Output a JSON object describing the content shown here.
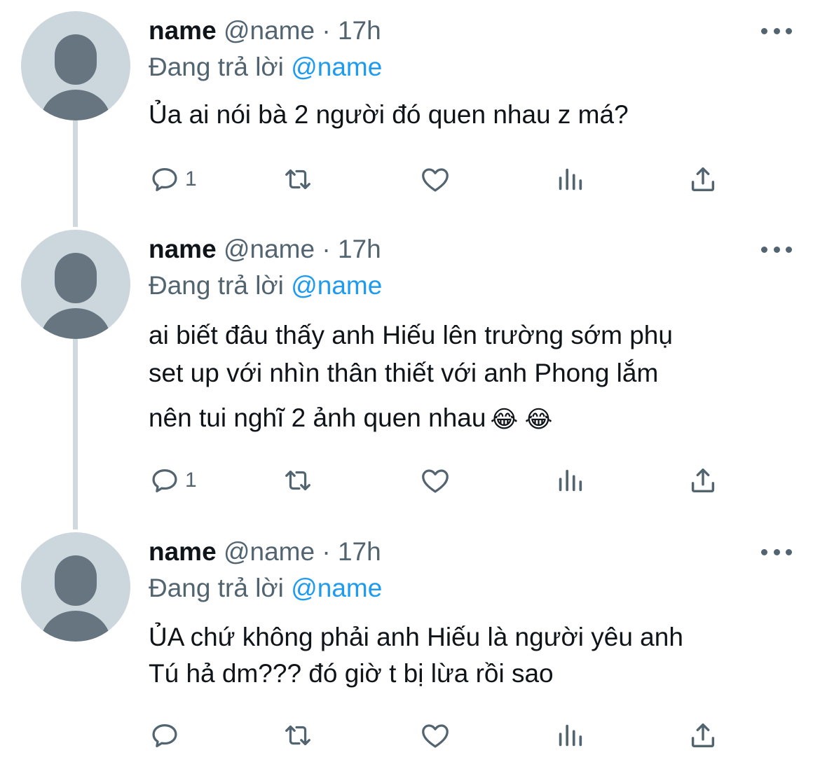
{
  "tweets": [
    {
      "display_name": "name",
      "handle": "@name",
      "separator": "·",
      "time": "17h",
      "reply_prefix": "Đang trả lời",
      "reply_to": "@name",
      "text_lines": [
        "Ủa ai nói bà 2 người đó quen nhau z má?"
      ],
      "emoji": "",
      "reply_count": "1"
    },
    {
      "display_name": "name",
      "handle": "@name",
      "separator": "·",
      "time": "17h",
      "reply_prefix": "Đang trả lời",
      "reply_to": "@name",
      "text_lines": [
        "ai biết đâu thấy anh Hiếu lên trường sớm phụ",
        "set up với nhìn thân thiết với anh Phong lắm",
        "nên tui nghĩ 2 ảnh quen nhau"
      ],
      "emoji": "😂 😂",
      "reply_count": "1"
    },
    {
      "display_name": "name",
      "handle": "@name",
      "separator": "·",
      "time": "17h",
      "reply_prefix": "Đang trả lời",
      "reply_to": "@name",
      "text_lines": [
        "ỦA chứ không phải anh Hiếu là người yêu anh",
        "Tú hả dm??? đó giờ t bị lừa rồi sao"
      ],
      "emoji": "",
      "reply_count": ""
    }
  ],
  "icons": {
    "reply": "reply-icon",
    "retweet": "retweet-icon",
    "like": "heart-icon",
    "stats": "analytics-icon",
    "share": "share-icon",
    "more": "more-dots-icon"
  },
  "colors": {
    "text": "#0f1419",
    "secondary": "#536471",
    "mention": "#1d9bf0",
    "thread_line": "#cfd9de",
    "avatar_bg": "#ccd6dd",
    "avatar_fg": "#66757f"
  }
}
